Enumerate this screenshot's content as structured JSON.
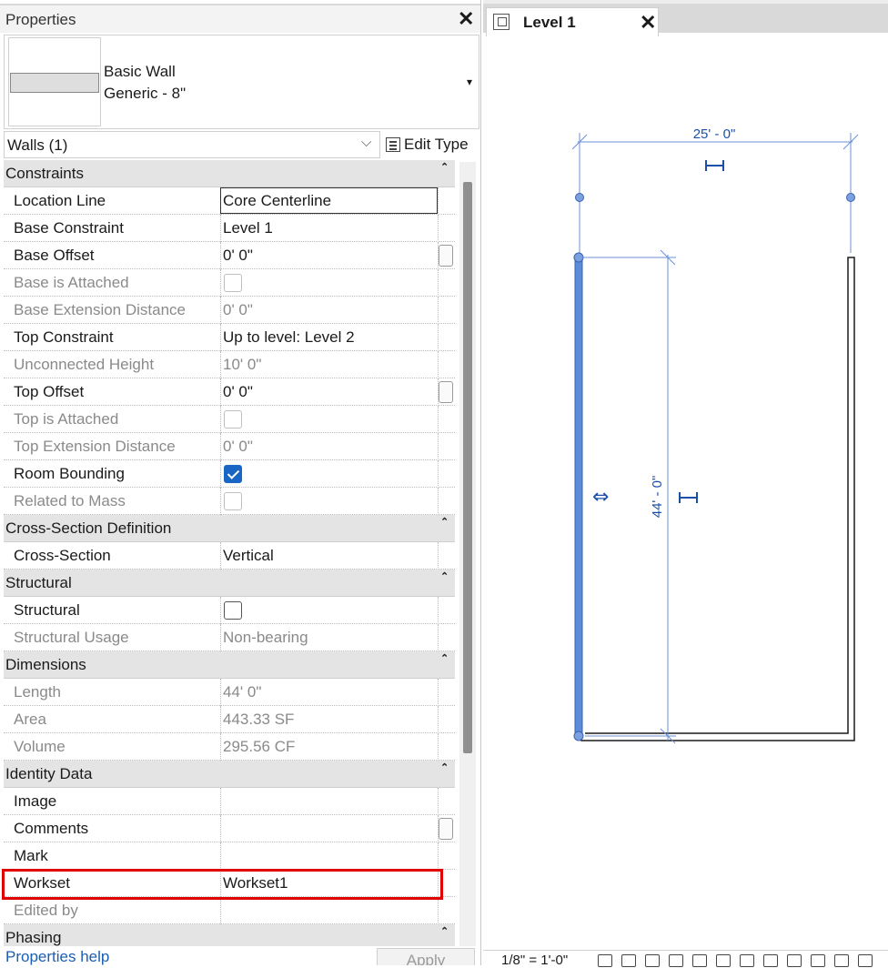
{
  "properties": {
    "title": "Properties",
    "close_glyph": "✕",
    "type_family": "Basic Wall",
    "type_name": "Generic - 8\"",
    "type_dropdown_glyph": "▾",
    "filter_label": "Walls (1)",
    "filter_chevron": "⌵",
    "edit_type_label": "Edit Type",
    "sections": [
      {
        "title": "Constraints",
        "rows": [
          {
            "label": "Location Line",
            "value": "Core Centerline"
          },
          {
            "label": "Base Constraint",
            "value": "Level 1"
          },
          {
            "label": "Base Offset",
            "value": "0'  0\""
          },
          {
            "label": "Base is Attached",
            "value": "",
            "checked": false
          },
          {
            "label": "Base Extension Distance",
            "value": "0'  0\""
          },
          {
            "label": "Top Constraint",
            "value": "Up to level: Level 2"
          },
          {
            "label": "Unconnected Height",
            "value": "10'  0\""
          },
          {
            "label": "Top Offset",
            "value": "0'  0\""
          },
          {
            "label": "Top is Attached",
            "value": "",
            "checked": false
          },
          {
            "label": "Top Extension Distance",
            "value": "0'  0\""
          },
          {
            "label": "Room Bounding",
            "value": "",
            "checked": true
          },
          {
            "label": "Related to Mass",
            "value": "",
            "checked": false
          }
        ]
      },
      {
        "title": "Cross-Section Definition",
        "rows": [
          {
            "label": "Cross-Section",
            "value": "Vertical"
          }
        ]
      },
      {
        "title": "Structural",
        "rows": [
          {
            "label": "Structural",
            "value": "",
            "checked": false
          },
          {
            "label": "Structural Usage",
            "value": "Non-bearing"
          }
        ]
      },
      {
        "title": "Dimensions",
        "rows": [
          {
            "label": "Length",
            "value": "44'  0\""
          },
          {
            "label": "Area",
            "value": "443.33 SF"
          },
          {
            "label": "Volume",
            "value": "295.56 CF"
          }
        ]
      },
      {
        "title": "Identity Data",
        "rows": [
          {
            "label": "Image",
            "value": ""
          },
          {
            "label": "Comments",
            "value": ""
          },
          {
            "label": "Mark",
            "value": ""
          },
          {
            "label": "Workset",
            "value": "Workset1"
          },
          {
            "label": "Edited by",
            "value": ""
          }
        ]
      },
      {
        "title": "Phasing",
        "rows": []
      }
    ],
    "collapse_glyph": "⌃",
    "help_link": "Properties help",
    "apply_label": "Apply"
  },
  "view": {
    "tab_label": "Level 1",
    "close_glyph": "✕",
    "dim_horizontal": "25' - 0\"",
    "dim_vertical": "44' - 0\"",
    "flip_glyph": "⇔",
    "scale": "1/8\" = 1'-0\""
  },
  "colors": {
    "selection_blue": "#5b8bd9",
    "dimension_blue": "#1d4fa8",
    "highlight_red": "#e00000",
    "checkbox_blue": "#1a66c4"
  }
}
